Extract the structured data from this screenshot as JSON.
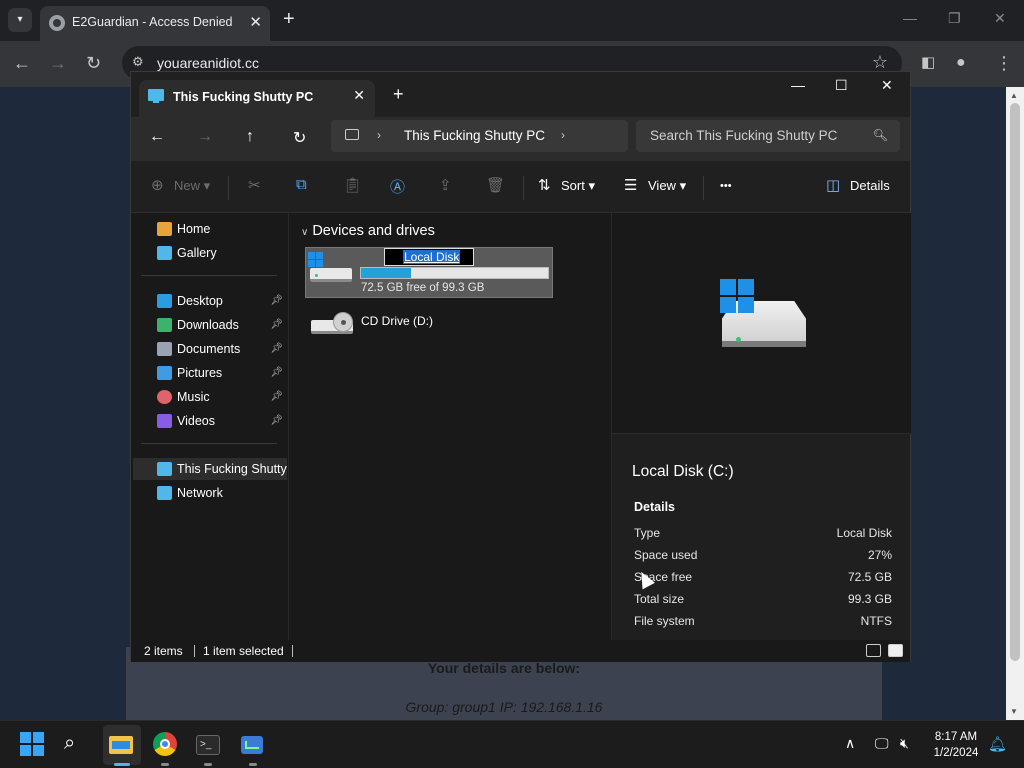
{
  "browser": {
    "tab_title": "E2Guardian - Access Denied",
    "url": "youareanidiot.cc"
  },
  "page": {
    "details_heading": "Your details are below:",
    "details_line": "Group: group1   IP: 192.168.1.16"
  },
  "explorer": {
    "tab_title": "This Fucking Shutty PC",
    "breadcrumb": "This Fucking Shutty PC",
    "search_placeholder": "Search This Fucking Shutty PC",
    "commands": {
      "new": "New",
      "sort": "Sort",
      "view": "View",
      "more": "•••",
      "details": "Details"
    },
    "nav": [
      {
        "label": "Home",
        "icon": "home-icon",
        "color": "#e8a33b",
        "pinned": false
      },
      {
        "label": "Gallery",
        "icon": "gallery-icon",
        "color": "#4fb7ea",
        "pinned": false
      },
      {
        "label": "Desktop",
        "icon": "desktop-icon",
        "color": "#2a9de0",
        "pinned": true
      },
      {
        "label": "Downloads",
        "icon": "downloads-icon",
        "color": "#3bb36c",
        "pinned": true
      },
      {
        "label": "Documents",
        "icon": "documents-icon",
        "color": "#9aa3b3",
        "pinned": true
      },
      {
        "label": "Pictures",
        "icon": "pictures-icon",
        "color": "#3f9be3",
        "pinned": true
      },
      {
        "label": "Music",
        "icon": "music-icon",
        "color": "#e0636b",
        "pinned": true
      },
      {
        "label": "Videos",
        "icon": "videos-icon",
        "color": "#8a5ce6",
        "pinned": true
      },
      {
        "label": "This Fucking Shutty PC",
        "icon": "this-pc-icon",
        "color": "#4fb7ea",
        "pinned": false
      },
      {
        "label": "Network",
        "icon": "network-icon",
        "color": "#4fb7ea",
        "pinned": false
      }
    ],
    "group_header": "Devices and drives",
    "drive_c": {
      "name": "Local Disk",
      "free_text": "72.5 GB free of 99.3 GB",
      "used_fraction": 0.27
    },
    "drive_d": {
      "name": "CD Drive (D:)"
    },
    "details_pane": {
      "title": "Local Disk (C:)",
      "section": "Details",
      "rows": [
        {
          "k": "Type",
          "v": "Local Disk"
        },
        {
          "k": "Space used",
          "v": "27%"
        },
        {
          "k": "Space free",
          "v": "72.5 GB"
        },
        {
          "k": "Total size",
          "v": "99.3 GB"
        },
        {
          "k": "File system",
          "v": "NTFS"
        }
      ]
    },
    "status": {
      "items": "2 items",
      "selected": "1 item selected"
    }
  },
  "taskbar": {
    "time": "8:17 AM",
    "date": "1/2/2024"
  }
}
